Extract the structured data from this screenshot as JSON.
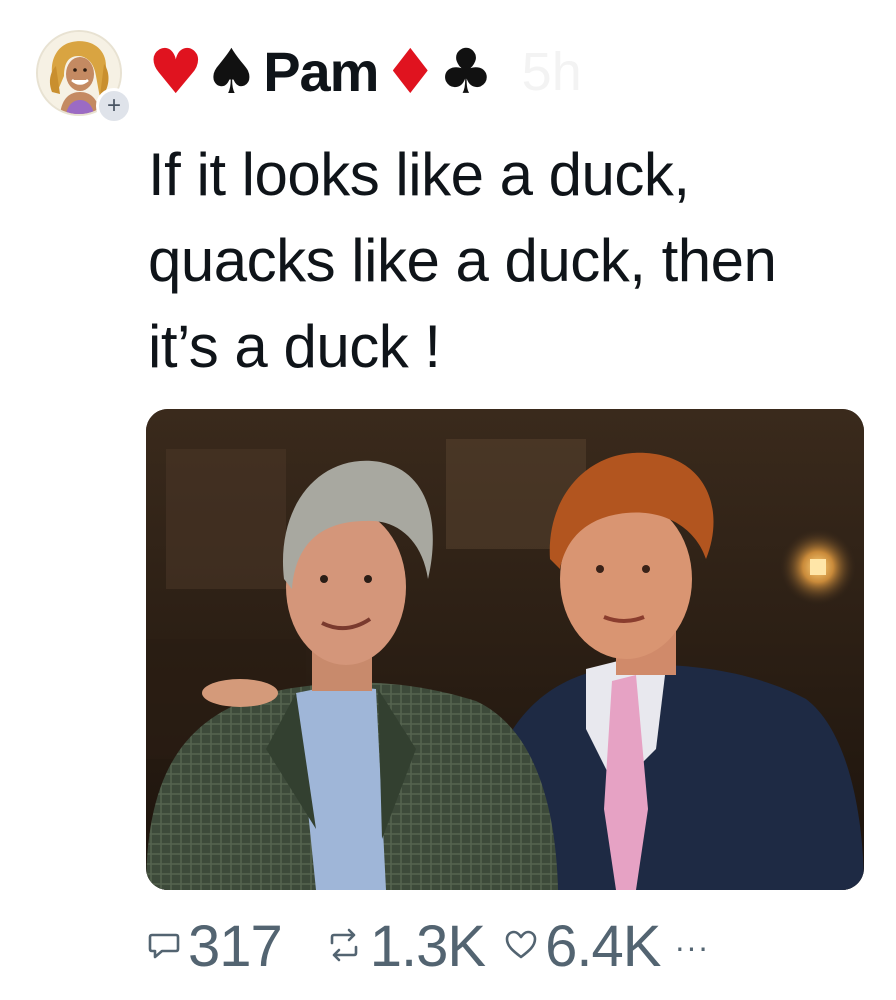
{
  "author": {
    "name": "Pam",
    "suits": [
      "♥",
      "♠",
      "♦",
      "♣"
    ],
    "follow_badge": "+",
    "timestamp": "5h",
    "avatar_icon": "cartoon-woman-avatar"
  },
  "post": {
    "text_lines": [
      "If it looks like a duck,",
      "quacks like a duck, then",
      "it’s a duck !"
    ],
    "media_icon": "photo-two-men"
  },
  "actions": {
    "replies": "317",
    "reposts": "1.3K",
    "likes": "6.4K",
    "more": "···"
  },
  "colors": {
    "suit_red": "#e0131f",
    "suit_black": "#111111",
    "text": "#0f1419",
    "muted": "#536471",
    "timestamp_faint": "#f3f3f3"
  }
}
